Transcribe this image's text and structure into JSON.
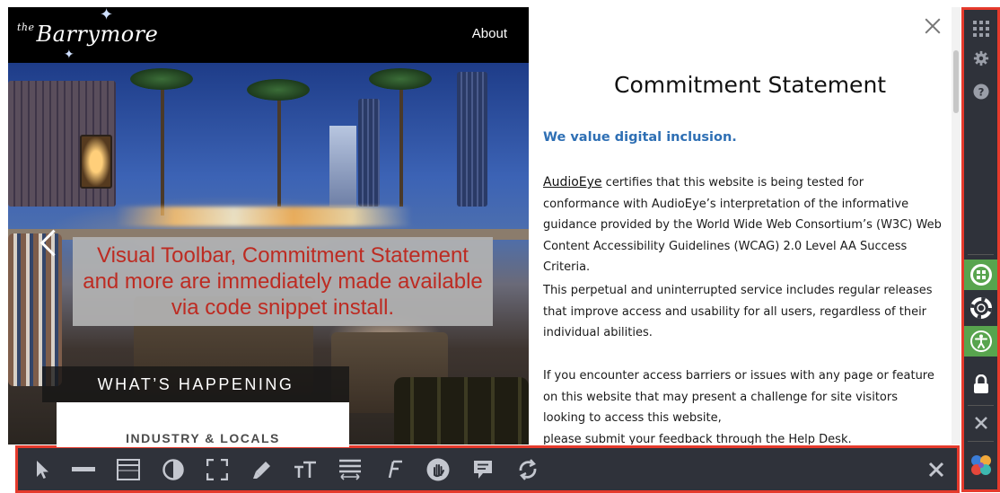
{
  "site": {
    "logo_prefix": "the",
    "logo_text": "Barrymore",
    "nav_about": "About",
    "overlay_lines": [
      "Visual Toolbar, Commitment Statement",
      "and more are immediately made available",
      "via code snippet install."
    ],
    "whats_happening": "WHAT’S HAPPENING",
    "card_heading": "INDUSTRY & LOCALS"
  },
  "panel": {
    "title": "Commitment Statement",
    "subtitle": "We value digital inclusion.",
    "p1_link": "AudioEye",
    "p1_text": " certifies that this website is being tested for conformance with AudioEye’s interpretation of the informative guidance provided by the World Wide Web Consortium’s (W3C) Web Content Accessibility Guidelines (WCAG) 2.0 Level AA Success Criteria.",
    "p2": "This perpetual and uninterrupted service includes regular releases that improve access and usability for all users, regardless of their individual abilities.",
    "p3": "If you encounter access barriers or issues with any page or feature on this website that may present a challenge for site visitors looking to access this website,",
    "p4": "please submit your feedback through the Help Desk."
  },
  "colors": {
    "highlight_border": "#e53a2c",
    "toolbar_bg": "#2f323a",
    "active_green": "#58a44e",
    "subtitle_blue": "#2e6fb4",
    "overlay_text": "#bd2b22"
  },
  "vertical_toolbar": [
    "apps-grid-icon",
    "gear-icon",
    "help-icon",
    "toolbar-toggle-icon",
    "help-desk-lifebuoy-icon",
    "accessibility-icon",
    "lock-icon",
    "close-icon",
    "brand-logo-icon"
  ],
  "bottom_toolbar": [
    "cursor-icon",
    "reading-line-icon",
    "page-mask-icon",
    "contrast-icon",
    "zoom-fit-icon",
    "highlighter-icon",
    "text-size-icon",
    "line-spacing-icon",
    "font-icon",
    "stop-animation-icon",
    "alt-text-icon",
    "reset-icon",
    "close-icon"
  ]
}
